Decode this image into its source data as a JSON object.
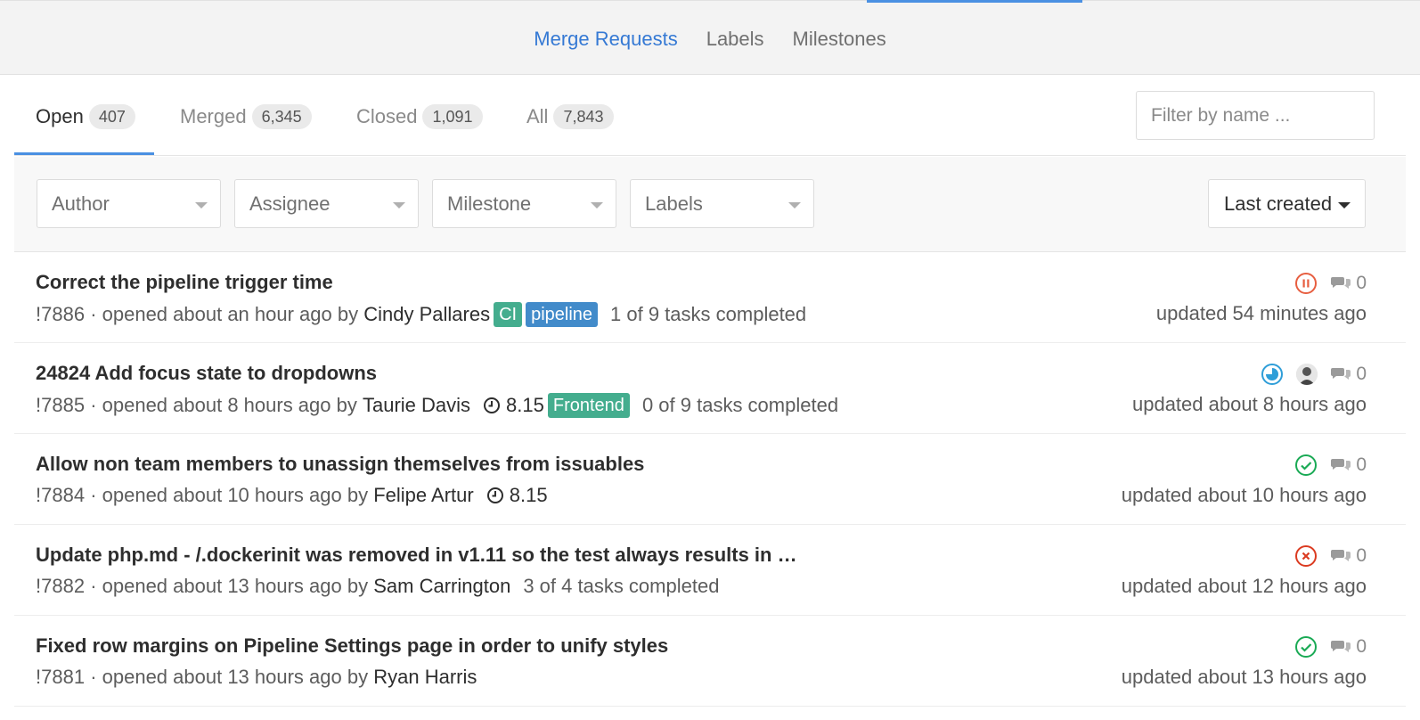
{
  "subnav": {
    "links": [
      {
        "label": "Merge Requests",
        "active": true
      },
      {
        "label": "Labels",
        "active": false
      },
      {
        "label": "Milestones",
        "active": false
      }
    ]
  },
  "tabs": [
    {
      "label": "Open",
      "count": "407",
      "active": true
    },
    {
      "label": "Merged",
      "count": "6,345",
      "active": false
    },
    {
      "label": "Closed",
      "count": "1,091",
      "active": false
    },
    {
      "label": "All",
      "count": "7,843",
      "active": false
    }
  ],
  "filter_input": {
    "placeholder": "Filter by name ..."
  },
  "filters": {
    "author": "Author",
    "assignee": "Assignee",
    "milestone": "Milestone",
    "labels": "Labels",
    "sort": "Last created"
  },
  "colors": {
    "accent": "#4a90e2",
    "label_ci": "#44ad8e",
    "label_pipeline": "#428bca",
    "label_frontend": "#44ad8e",
    "status_paused": "#e75e40",
    "status_running": "#2f9ed8",
    "status_success": "#1aaa55",
    "status_failed": "#db3b21"
  },
  "merge_requests": [
    {
      "title": "Correct the pipeline trigger time",
      "iid": "!7886",
      "opened": "· opened about an hour ago by",
      "author": "Cindy Pallares",
      "labels": [
        "CI",
        "pipeline"
      ],
      "milestone": "",
      "tasks": "1 of 9 tasks completed",
      "status": "paused",
      "comments": "0",
      "updated": "updated 54 minutes ago"
    },
    {
      "title": "24824 Add focus state to dropdowns",
      "iid": "!7885",
      "opened": "· opened about 8 hours ago by",
      "author": "Taurie Davis",
      "labels": [
        "Frontend"
      ],
      "milestone": "8.15",
      "tasks": "0 of 9 tasks completed",
      "status": "running",
      "comments": "0",
      "updated": "updated about 8 hours ago"
    },
    {
      "title": "Allow non team members to unassign themselves from issuables",
      "iid": "!7884",
      "opened": "· opened about 10 hours ago by",
      "author": "Felipe Artur",
      "labels": [],
      "milestone": "8.15",
      "tasks": "",
      "status": "success",
      "comments": "0",
      "updated": "updated about 10 hours ago"
    },
    {
      "title": "Update php.md - /.dockerinit was removed in v1.11 so the test always results in …",
      "iid": "!7882",
      "opened": "· opened about 13 hours ago by",
      "author": "Sam Carrington",
      "labels": [],
      "milestone": "",
      "tasks": "3 of 4 tasks completed",
      "status": "failed",
      "comments": "0",
      "updated": "updated about 12 hours ago"
    },
    {
      "title": "Fixed row margins on Pipeline Settings page in order to unify styles",
      "iid": "!7881",
      "opened": "· opened about 13 hours ago by",
      "author": "Ryan Harris",
      "labels": [],
      "milestone": "",
      "tasks": "",
      "status": "success",
      "comments": "0",
      "updated": "updated about 13 hours ago"
    }
  ]
}
